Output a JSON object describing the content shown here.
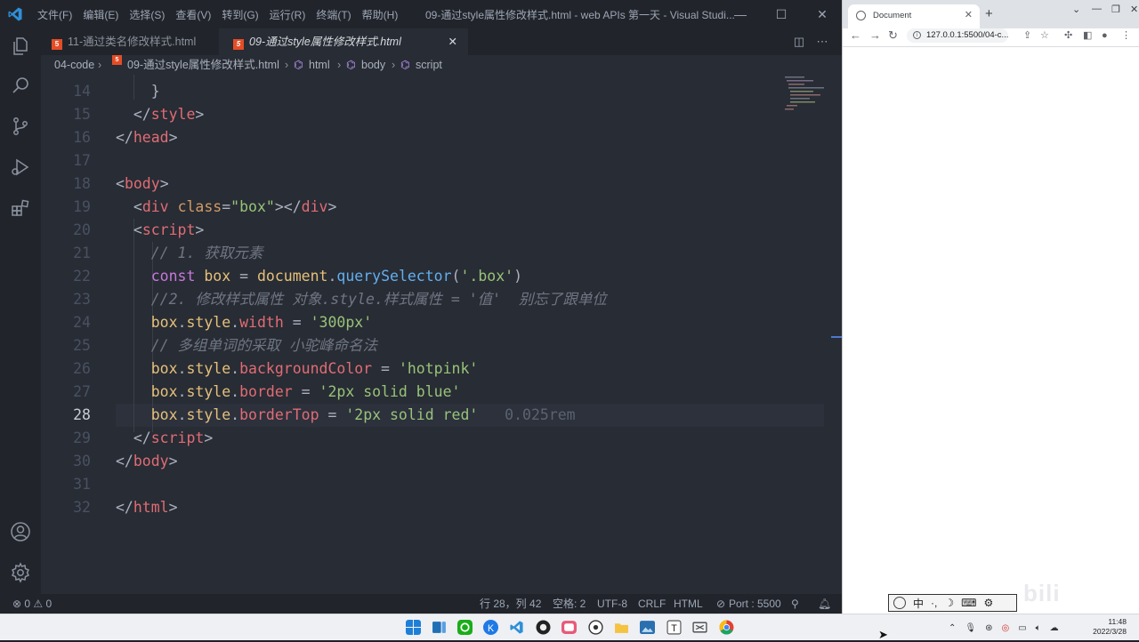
{
  "vscode": {
    "menus": [
      "文件(F)",
      "编辑(E)",
      "选择(S)",
      "查看(V)",
      "转到(G)",
      "运行(R)",
      "终端(T)",
      "帮助(H)"
    ],
    "title": "09-通过style属性修改样式.html - web APIs 第一天 - Visual Studi...",
    "tabs": [
      {
        "label": "11-通过类名修改样式.html",
        "active": false
      },
      {
        "label": "09-通过style属性修改样式.html",
        "active": true
      }
    ],
    "breadcrumb": [
      "04-code",
      "09-通过style属性修改样式.html",
      "html",
      "body",
      "script"
    ],
    "code_lines": [
      {
        "n": "14",
        "tokens": [
          [
            "pun",
            "    }"
          ]
        ]
      },
      {
        "n": "15",
        "tokens": [
          [
            "pun",
            "  </"
          ],
          [
            "tag",
            "style"
          ],
          [
            "pun",
            ">"
          ]
        ]
      },
      {
        "n": "16",
        "tokens": [
          [
            "pun",
            "</"
          ],
          [
            "tag",
            "head"
          ],
          [
            "pun",
            ">"
          ]
        ]
      },
      {
        "n": "17",
        "tokens": []
      },
      {
        "n": "18",
        "tokens": [
          [
            "pun",
            "<"
          ],
          [
            "tag",
            "body"
          ],
          [
            "pun",
            ">"
          ]
        ]
      },
      {
        "n": "19",
        "tokens": [
          [
            "pun",
            "  <"
          ],
          [
            "tag",
            "div"
          ],
          [
            "pun",
            " "
          ],
          [
            "attr",
            "class"
          ],
          [
            "pun",
            "="
          ],
          [
            "str",
            "\"box\""
          ],
          [
            "pun",
            "></"
          ],
          [
            "tag",
            "div"
          ],
          [
            "pun",
            ">"
          ]
        ]
      },
      {
        "n": "20",
        "tokens": [
          [
            "pun",
            "  <"
          ],
          [
            "tag",
            "script"
          ],
          [
            "pun",
            ">"
          ]
        ]
      },
      {
        "n": "21",
        "tokens": [
          [
            "pun",
            "    "
          ],
          [
            "cm",
            "// 1. 获取元素"
          ]
        ]
      },
      {
        "n": "22",
        "tokens": [
          [
            "pun",
            "    "
          ],
          [
            "kw",
            "const"
          ],
          [
            "pun",
            " "
          ],
          [
            "var",
            "box"
          ],
          [
            "pun",
            " = "
          ],
          [
            "var",
            "document"
          ],
          [
            "pun",
            "."
          ],
          [
            "fn",
            "querySelector"
          ],
          [
            "pun",
            "("
          ],
          [
            "str",
            "'.box'"
          ],
          [
            "pun",
            ")"
          ]
        ]
      },
      {
        "n": "23",
        "tokens": [
          [
            "pun",
            "    "
          ],
          [
            "cm",
            "//2. 修改样式属性 对象.style.样式属性 = '值'  别忘了跟单位"
          ]
        ]
      },
      {
        "n": "24",
        "tokens": [
          [
            "pun",
            "    "
          ],
          [
            "var",
            "box"
          ],
          [
            "pun",
            "."
          ],
          [
            "var",
            "style"
          ],
          [
            "pun",
            "."
          ],
          [
            "prop",
            "width"
          ],
          [
            "pun",
            " = "
          ],
          [
            "str",
            "'300px'"
          ]
        ]
      },
      {
        "n": "25",
        "tokens": [
          [
            "pun",
            "    "
          ],
          [
            "cm",
            "// 多组单词的采取 小驼峰命名法"
          ]
        ]
      },
      {
        "n": "26",
        "tokens": [
          [
            "pun",
            "    "
          ],
          [
            "var",
            "box"
          ],
          [
            "pun",
            "."
          ],
          [
            "var",
            "style"
          ],
          [
            "pun",
            "."
          ],
          [
            "prop",
            "backgroundColor"
          ],
          [
            "pun",
            " = "
          ],
          [
            "str",
            "'hotpink'"
          ]
        ]
      },
      {
        "n": "27",
        "tokens": [
          [
            "pun",
            "    "
          ],
          [
            "var",
            "box"
          ],
          [
            "pun",
            "."
          ],
          [
            "var",
            "style"
          ],
          [
            "pun",
            "."
          ],
          [
            "prop",
            "border"
          ],
          [
            "pun",
            " = "
          ],
          [
            "str",
            "'2px solid blue'"
          ]
        ]
      },
      {
        "n": "28",
        "tokens": [
          [
            "pun",
            "    "
          ],
          [
            "var",
            "box"
          ],
          [
            "pun",
            "."
          ],
          [
            "var",
            "style"
          ],
          [
            "pun",
            "."
          ],
          [
            "prop",
            "borderTop"
          ],
          [
            "pun",
            " = "
          ],
          [
            "str",
            "'2px solid red'"
          ],
          [
            "ghost",
            "   0.025rem"
          ]
        ],
        "current": true
      },
      {
        "n": "29",
        "tokens": [
          [
            "pun",
            "  </"
          ],
          [
            "tag",
            "script"
          ],
          [
            "pun",
            ">"
          ]
        ]
      },
      {
        "n": "30",
        "tokens": [
          [
            "pun",
            "</"
          ],
          [
            "tag",
            "body"
          ],
          [
            "pun",
            ">"
          ]
        ]
      },
      {
        "n": "31",
        "tokens": []
      },
      {
        "n": "32",
        "tokens": [
          [
            "pun",
            "</"
          ],
          [
            "tag",
            "html"
          ],
          [
            "pun",
            ">"
          ]
        ]
      }
    ],
    "status": {
      "problems": "⊗ 0 ⚠ 0",
      "position": "行 28，列 42",
      "spaces": "空格: 2",
      "encoding": "UTF-8",
      "eol": "CRLF",
      "language": "HTML",
      "port": "Port : 5500"
    }
  },
  "browser": {
    "tab_title": "Document",
    "url": "127.0.0.1:5500/04-c..."
  },
  "ime": {
    "label": "中"
  },
  "taskbar": {
    "time": "11:48",
    "date": "2022/3/28"
  },
  "colors": {
    "editor_bg": "#282c34",
    "tag": "#e06c75",
    "string": "#98c379",
    "keyword": "#c678dd",
    "function": "#61afef",
    "comment": "#6f7683"
  }
}
